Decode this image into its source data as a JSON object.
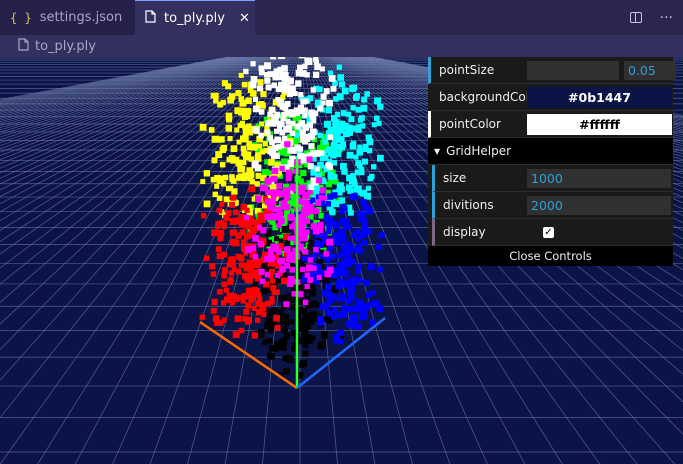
{
  "tabs": [
    {
      "label": "settings.json",
      "icon": "json-braces-icon",
      "active": false
    },
    {
      "label": "to_ply.ply",
      "icon": "file-icon",
      "active": true
    }
  ],
  "breadcrumb": {
    "file": "to_ply.ply",
    "icon": "file-icon"
  },
  "editor_actions": [
    {
      "icon": "split-editor-icon"
    },
    {
      "icon": "more-actions-icon"
    }
  ],
  "gui": {
    "pointSize": {
      "label": "pointSize",
      "value": "0.05",
      "fraction": 0.0
    },
    "backgroundColor": {
      "label": "backgroundColor",
      "value": "#0b1447",
      "color": "#0b1447"
    },
    "pointColor": {
      "label": "pointColor",
      "value": "#ffffff",
      "color": "#ffffff"
    },
    "gridHelper": {
      "title": "GridHelper",
      "size": {
        "label": "size",
        "value": "1000"
      },
      "divitions": {
        "label": "divitions",
        "value": "2000"
      },
      "display": {
        "label": "display",
        "checked": true
      }
    },
    "close": "Close Controls"
  },
  "colors": {
    "background": "#0b1447",
    "grid": "#6c79a8",
    "accent": "#2fa1d6"
  },
  "scene": {
    "point_colors": [
      "#ffff00",
      "#ffffff",
      "#00ffff",
      "#00ff00",
      "#ff0000",
      "#0000ff",
      "#000000",
      "#ff00ff"
    ]
  }
}
